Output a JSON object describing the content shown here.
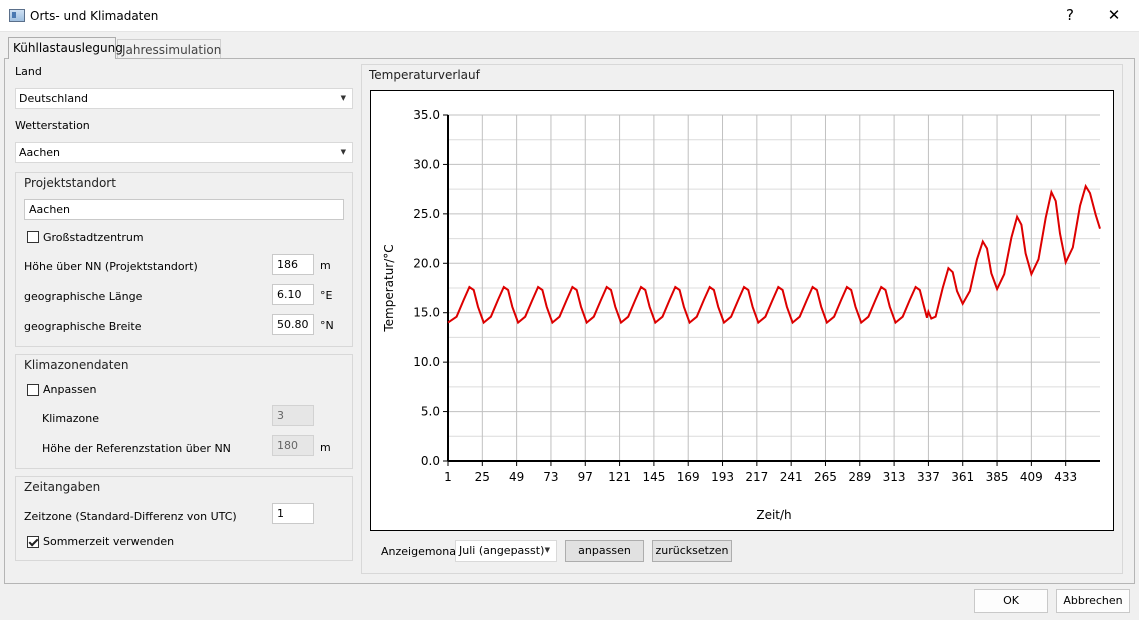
{
  "window": {
    "title": "Orts- und Klimadaten",
    "help": "?",
    "close": "✕"
  },
  "tabs": [
    {
      "label": "Kühllastauslegung"
    },
    {
      "label": "Jahressimulation"
    }
  ],
  "land": {
    "label": "Land",
    "value": "Deutschland"
  },
  "wetterstation": {
    "label": "Wetterstation",
    "value": "Aachen"
  },
  "projektstandort": {
    "title": "Projektstandort",
    "name": "Aachen",
    "grossstadt": "Großstadtzentrum",
    "hoehe_label": "Höhe über NN (Projektstandort)",
    "hoehe_value": "186",
    "hoehe_unit": "m",
    "laenge_label": "geographische Länge",
    "laenge_value": "6.10",
    "laenge_unit": "°E",
    "breite_label": "geographische Breite",
    "breite_value": "50.80",
    "breite_unit": "°N"
  },
  "klimazonendaten": {
    "title": "Klimazonendaten",
    "anpassen": "Anpassen",
    "klimazone_label": "Klimazone",
    "klimazone_value": "3",
    "ref_label": "Höhe der Referenzstation über NN",
    "ref_value": "180",
    "ref_unit": "m"
  },
  "zeitangaben": {
    "title": "Zeitangaben",
    "zeitzone_label": "Zeitzone (Standard-Differenz von UTC)",
    "zeitzone_value": "1",
    "sommerzeit": "Sommerzeit verwenden"
  },
  "temperatur": {
    "title": "Temperaturverlauf",
    "anzeigemonat_label": "Anzeigemonat",
    "anzeigemonat_value": "Juli (angepasst)",
    "anpassen_button": "anpassen",
    "zuruecksetzen_button": "zurücksetzen"
  },
  "footer": {
    "ok": "OK",
    "abbrechen": "Abbrechen"
  },
  "colors": {
    "line": "#dd0000",
    "grid": "#c0c0c0"
  },
  "chart_data": {
    "type": "line",
    "xlabel": "Zeit/h",
    "ylabel": "Temperatur/°C",
    "xlim": [
      1,
      457
    ],
    "ylim": [
      0,
      35
    ],
    "x_ticks": [
      "1",
      "25",
      "49",
      "73",
      "97",
      "121",
      "145",
      "169",
      "193",
      "217",
      "241",
      "265",
      "289",
      "313",
      "337",
      "361",
      "385",
      "409",
      "433"
    ],
    "y_ticks": [
      "0.0",
      "5.0",
      "10.0",
      "15.0",
      "20.0",
      "25.0",
      "30.0",
      "35.0"
    ],
    "grid": true,
    "series": [
      {
        "points": [
          [
            1,
            14.0
          ],
          [
            7,
            14.6
          ],
          [
            12,
            16.3
          ],
          [
            16,
            17.6
          ],
          [
            19,
            17.3
          ],
          [
            22,
            15.6
          ],
          [
            26,
            14.0
          ],
          [
            31,
            14.6
          ],
          [
            36,
            16.3
          ],
          [
            40,
            17.6
          ],
          [
            43,
            17.3
          ],
          [
            46,
            15.6
          ],
          [
            50,
            14.0
          ],
          [
            55,
            14.6
          ],
          [
            60,
            16.3
          ],
          [
            64,
            17.6
          ],
          [
            67,
            17.3
          ],
          [
            70,
            15.6
          ],
          [
            74,
            14.0
          ],
          [
            79,
            14.6
          ],
          [
            84,
            16.3
          ],
          [
            88,
            17.6
          ],
          [
            91,
            17.3
          ],
          [
            94,
            15.6
          ],
          [
            98,
            14.0
          ],
          [
            103,
            14.6
          ],
          [
            108,
            16.3
          ],
          [
            112,
            17.6
          ],
          [
            115,
            17.3
          ],
          [
            118,
            15.6
          ],
          [
            122,
            14.0
          ],
          [
            127,
            14.6
          ],
          [
            132,
            16.3
          ],
          [
            136,
            17.6
          ],
          [
            139,
            17.3
          ],
          [
            142,
            15.6
          ],
          [
            146,
            14.0
          ],
          [
            151,
            14.6
          ],
          [
            156,
            16.3
          ],
          [
            160,
            17.6
          ],
          [
            163,
            17.3
          ],
          [
            166,
            15.6
          ],
          [
            170,
            14.0
          ],
          [
            175,
            14.6
          ],
          [
            180,
            16.3
          ],
          [
            184,
            17.6
          ],
          [
            187,
            17.3
          ],
          [
            190,
            15.6
          ],
          [
            194,
            14.0
          ],
          [
            199,
            14.6
          ],
          [
            204,
            16.3
          ],
          [
            208,
            17.6
          ],
          [
            211,
            17.3
          ],
          [
            214,
            15.6
          ],
          [
            218,
            14.0
          ],
          [
            223,
            14.6
          ],
          [
            228,
            16.3
          ],
          [
            232,
            17.6
          ],
          [
            235,
            17.3
          ],
          [
            238,
            15.6
          ],
          [
            242,
            14.0
          ],
          [
            247,
            14.6
          ],
          [
            252,
            16.3
          ],
          [
            256,
            17.6
          ],
          [
            259,
            17.3
          ],
          [
            262,
            15.6
          ],
          [
            266,
            14.0
          ],
          [
            271,
            14.6
          ],
          [
            276,
            16.3
          ],
          [
            280,
            17.6
          ],
          [
            283,
            17.3
          ],
          [
            286,
            15.6
          ],
          [
            290,
            14.0
          ],
          [
            295,
            14.6
          ],
          [
            300,
            16.3
          ],
          [
            304,
            17.6
          ],
          [
            307,
            17.3
          ],
          [
            310,
            15.6
          ],
          [
            314,
            14.0
          ],
          [
            319,
            14.6
          ],
          [
            324,
            16.3
          ],
          [
            328,
            17.6
          ],
          [
            331,
            17.3
          ],
          [
            334,
            15.6
          ],
          [
            336,
            14.5
          ],
          [
            337,
            15.1
          ],
          [
            339,
            14.4
          ],
          [
            342,
            14.6
          ],
          [
            347,
            17.5
          ],
          [
            351,
            19.5
          ],
          [
            354,
            19.1
          ],
          [
            357,
            17.2
          ],
          [
            361,
            15.9
          ],
          [
            366,
            17.2
          ],
          [
            371,
            20.4
          ],
          [
            375,
            22.2
          ],
          [
            378,
            21.5
          ],
          [
            381,
            19.0
          ],
          [
            385,
            17.4
          ],
          [
            390,
            18.9
          ],
          [
            395,
            22.6
          ],
          [
            399,
            24.7
          ],
          [
            402,
            23.9
          ],
          [
            405,
            21.0
          ],
          [
            409,
            18.9
          ],
          [
            414,
            20.4
          ],
          [
            419,
            24.6
          ],
          [
            423,
            27.2
          ],
          [
            426,
            26.3
          ],
          [
            429,
            23.0
          ],
          [
            433,
            20.1
          ],
          [
            438,
            21.6
          ],
          [
            443,
            25.8
          ],
          [
            447,
            27.8
          ],
          [
            450,
            27.1
          ],
          [
            454,
            24.9
          ],
          [
            457,
            23.5
          ]
        ]
      }
    ]
  }
}
